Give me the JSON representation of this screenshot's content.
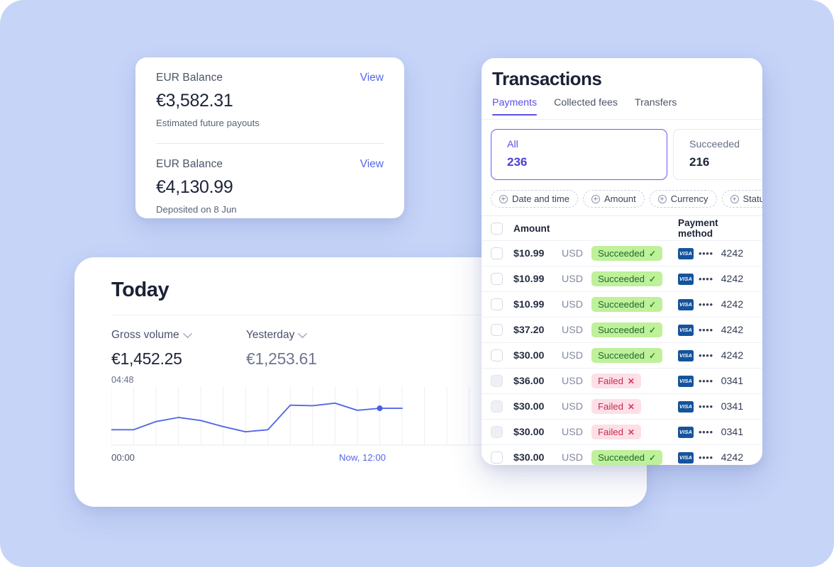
{
  "theme": {
    "background": "#c6d4f8",
    "accent_purple": "#5b4ee8",
    "accent_blue": "#5468e8",
    "success_bg": "#bff09a",
    "success_fg": "#1e6b2f",
    "fail_bg": "#fde0e7",
    "fail_fg": "#c8294f",
    "visa_blue": "#15549c"
  },
  "balance_card": {
    "blocks": [
      {
        "label": "EUR Balance",
        "view_label": "View",
        "amount": "€3,582.31",
        "sub": "Estimated future payouts"
      },
      {
        "label": "EUR Balance",
        "view_label": "View",
        "amount": "€4,130.99",
        "sub": "Deposited on 8 Jun"
      }
    ]
  },
  "today_card": {
    "title": "Today",
    "metrics": [
      {
        "label": "Gross volume",
        "value": "€1,452.25",
        "time": "04:48"
      },
      {
        "label": "Yesterday",
        "value": "€1,253.61",
        "time": ""
      }
    ],
    "x_axis": {
      "start": "00:00",
      "now": "Now, 12:00"
    }
  },
  "chart_data": {
    "type": "line",
    "title": "Gross volume",
    "xlabel": "",
    "ylabel": "",
    "grid": true,
    "legend": false,
    "x_tick_labels": [
      "00:00",
      "Now, 12:00"
    ],
    "series": [
      {
        "name": "Gross volume",
        "color": "#5468e8",
        "x": [
          0,
          1,
          2,
          3,
          4,
          5,
          6,
          7,
          8,
          9,
          10,
          11,
          12,
          13
        ],
        "values": [
          26,
          26,
          42,
          50,
          44,
          32,
          22,
          26,
          74,
          73,
          78,
          64,
          68,
          68
        ],
        "last_point_marker": true,
        "marker_index": 12
      }
    ],
    "ylim": [
      0,
      100
    ],
    "xlim": [
      0,
      26
    ],
    "gridline_count": 26
  },
  "transactions_card": {
    "title": "Transactions",
    "tabs": [
      {
        "label": "Payments",
        "active": true
      },
      {
        "label": "Collected fees",
        "active": false
      },
      {
        "label": "Transfers",
        "active": false
      }
    ],
    "summary_tiles": [
      {
        "label": "All",
        "count": "236",
        "selected": true
      },
      {
        "label": "Succeeded",
        "count": "216",
        "selected": false
      }
    ],
    "filters": [
      {
        "label": "Date and time",
        "icon": "plus-circle-icon"
      },
      {
        "label": "Amount",
        "icon": "plus-circle-icon"
      },
      {
        "label": "Currency",
        "icon": "plus-circle-icon"
      },
      {
        "label": "Status",
        "icon": "plus-circle-icon"
      },
      {
        "label": "",
        "icon": "plus-circle-icon"
      }
    ],
    "table": {
      "columns": [
        "Amount",
        "Payment method"
      ],
      "rows": [
        {
          "amount": "$10.99",
          "currency": "USD",
          "status": "Succeeded",
          "status_type": "ok",
          "brand": "VISA",
          "dots": "••••",
          "last4": "4242",
          "checkbox": "empty"
        },
        {
          "amount": "$10.99",
          "currency": "USD",
          "status": "Succeeded",
          "status_type": "ok",
          "brand": "VISA",
          "dots": "••••",
          "last4": "4242",
          "checkbox": "empty"
        },
        {
          "amount": "$10.99",
          "currency": "USD",
          "status": "Succeeded",
          "status_type": "ok",
          "brand": "VISA",
          "dots": "••••",
          "last4": "4242",
          "checkbox": "empty"
        },
        {
          "amount": "$37.20",
          "currency": "USD",
          "status": "Succeeded",
          "status_type": "ok",
          "brand": "VISA",
          "dots": "••••",
          "last4": "4242",
          "checkbox": "empty"
        },
        {
          "amount": "$30.00",
          "currency": "USD",
          "status": "Succeeded",
          "status_type": "ok",
          "brand": "VISA",
          "dots": "••••",
          "last4": "4242",
          "checkbox": "empty"
        },
        {
          "amount": "$36.00",
          "currency": "USD",
          "status": "Failed",
          "status_type": "fail",
          "brand": "VISA",
          "dots": "••••",
          "last4": "0341",
          "checkbox": "dim"
        },
        {
          "amount": "$30.00",
          "currency": "USD",
          "status": "Failed",
          "status_type": "fail",
          "brand": "VISA",
          "dots": "••••",
          "last4": "0341",
          "checkbox": "dim"
        },
        {
          "amount": "$30.00",
          "currency": "USD",
          "status": "Failed",
          "status_type": "fail",
          "brand": "VISA",
          "dots": "••••",
          "last4": "0341",
          "checkbox": "dim"
        },
        {
          "amount": "$30.00",
          "currency": "USD",
          "status": "Succeeded",
          "status_type": "ok",
          "brand": "VISA",
          "dots": "••••",
          "last4": "4242",
          "checkbox": "empty"
        }
      ]
    }
  }
}
